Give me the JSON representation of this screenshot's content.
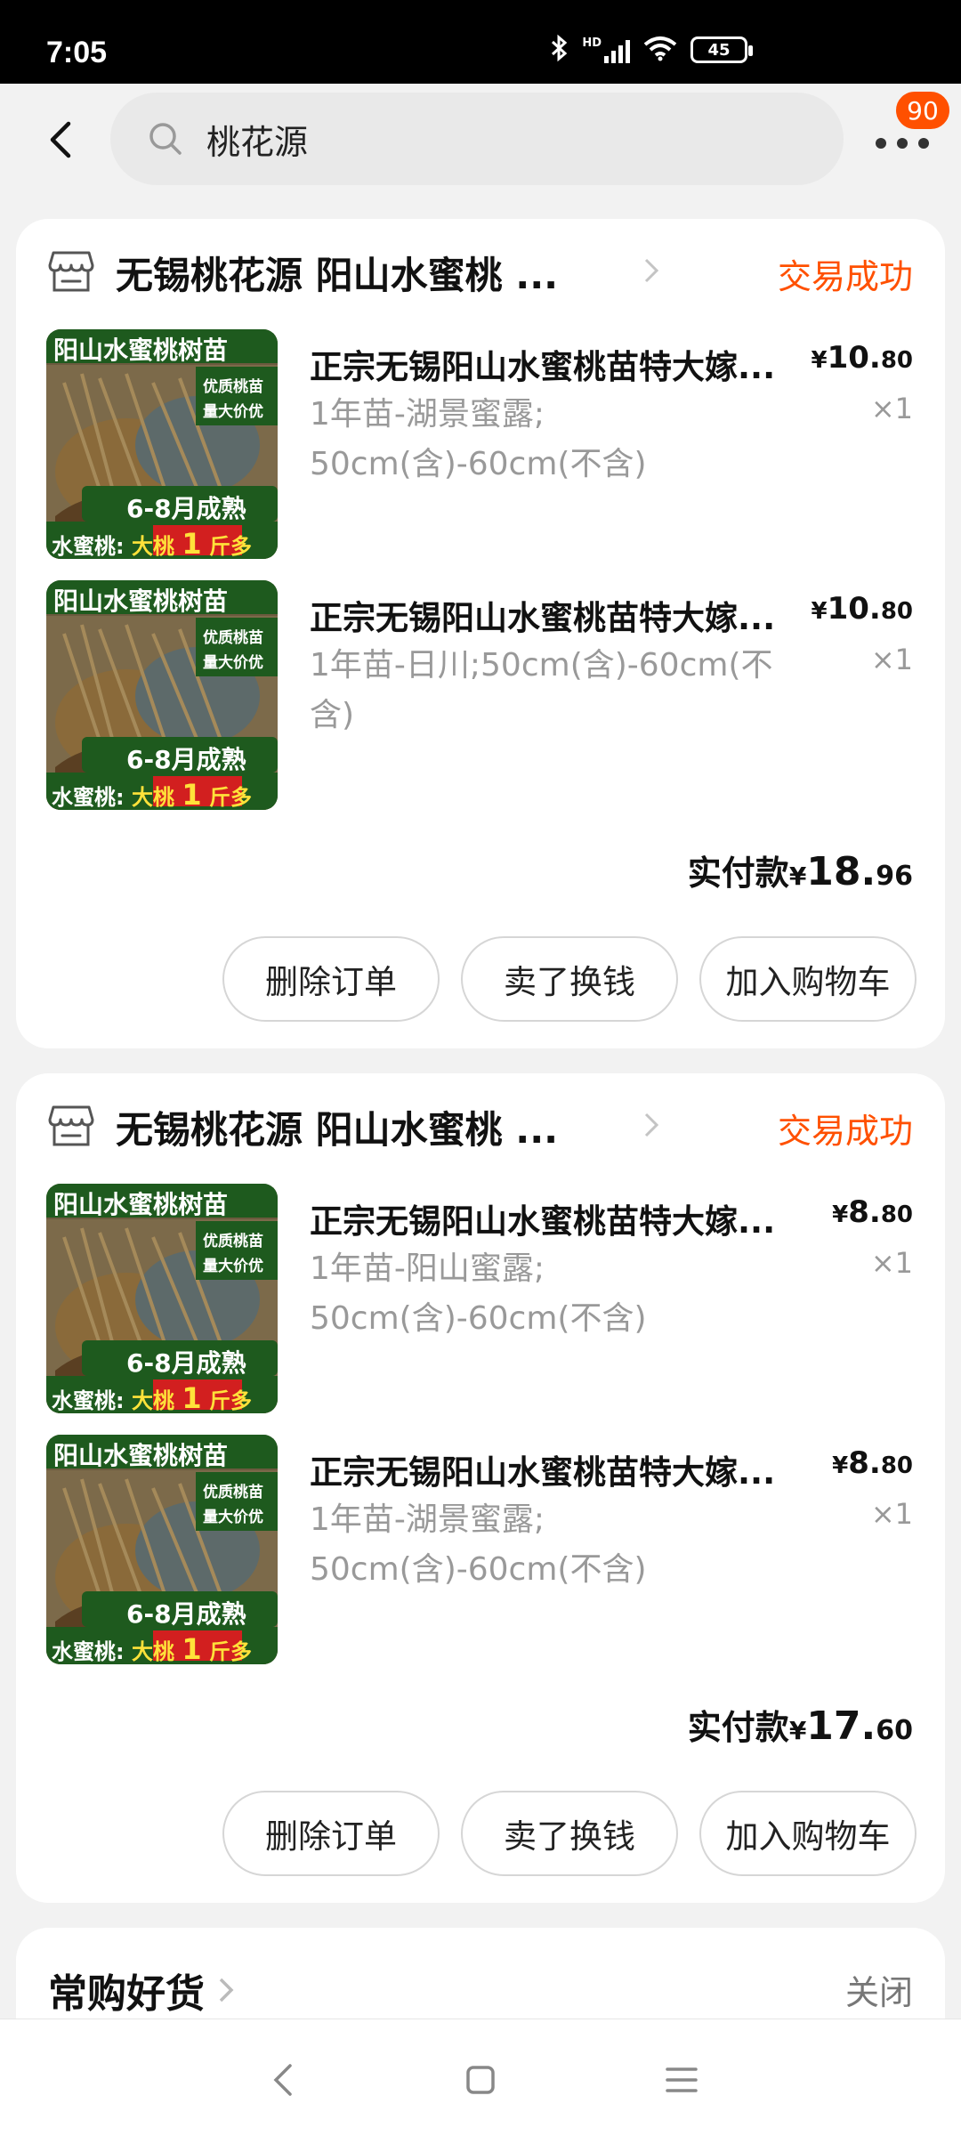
{
  "status_bar": {
    "time": "7:05",
    "hd_label": "HD",
    "battery": "45",
    "icons": [
      "bluetooth-icon",
      "cell-signal-icon",
      "wifi-icon",
      "battery-icon"
    ]
  },
  "header": {
    "search_text": "桃花源",
    "notification_count": "90",
    "icons": [
      "back-icon",
      "search-icon",
      "more-icon"
    ]
  },
  "orders": [
    {
      "store_name": "无锡桃花源  阳山水蜜桃 ...",
      "status": "交易成功",
      "items": [
        {
          "title": "正宗无锡阳山水蜜桃苗特大嫁...",
          "sku": "1年苗-湖景蜜露;\n50cm(含)-60cm(不含)",
          "price_symbol": "¥",
          "price_int": "10.",
          "price_dec": "80",
          "qty": "×1"
        },
        {
          "title": "正宗无锡阳山水蜜桃苗特大嫁...",
          "sku": "1年苗-日川;50cm(含)-60cm(不含)",
          "price_symbol": "¥",
          "price_int": "10.",
          "price_dec": "80",
          "qty": "×1"
        }
      ],
      "total_label": "实付款",
      "total_symbol": "¥",
      "total_int": "18.",
      "total_dec": "96",
      "buttons": [
        "删除订单",
        "卖了换钱",
        "加入购物车"
      ]
    },
    {
      "store_name": "无锡桃花源  阳山水蜜桃 ...",
      "status": "交易成功",
      "items": [
        {
          "title": "正宗无锡阳山水蜜桃苗特大嫁...",
          "sku": "1年苗-阳山蜜露;\n50cm(含)-60cm(不含)",
          "price_symbol": "¥",
          "price_int": "8.",
          "price_dec": "80",
          "qty": "×1"
        },
        {
          "title": "正宗无锡阳山水蜜桃苗特大嫁...",
          "sku": "1年苗-湖景蜜露;\n50cm(含)-60cm(不含)",
          "price_symbol": "¥",
          "price_int": "8.",
          "price_dec": "80",
          "qty": "×1"
        }
      ],
      "total_label": "实付款",
      "total_symbol": "¥",
      "total_int": "17.",
      "total_dec": "60",
      "buttons": [
        "删除订单",
        "卖了换钱",
        "加入购物车"
      ]
    }
  ],
  "product_image": {
    "banner": "阳山水蜜桃树苗",
    "tag_line1": "优质桃苗",
    "tag_line2": "量大价优",
    "ripe": "6-8月成熟",
    "bottom_prefix": "水蜜桃:",
    "bottom_mid": "大桃",
    "bottom_num": "1",
    "bottom_suffix": "斤多"
  },
  "frequent_goods": {
    "title": "常购好货",
    "close": "关闭"
  },
  "nav_bar": {
    "icons": [
      "nav-back-icon",
      "nav-home-icon",
      "nav-menu-icon"
    ]
  },
  "colors": {
    "accent": "#ff5000",
    "image_green": "#1e5a1e"
  }
}
